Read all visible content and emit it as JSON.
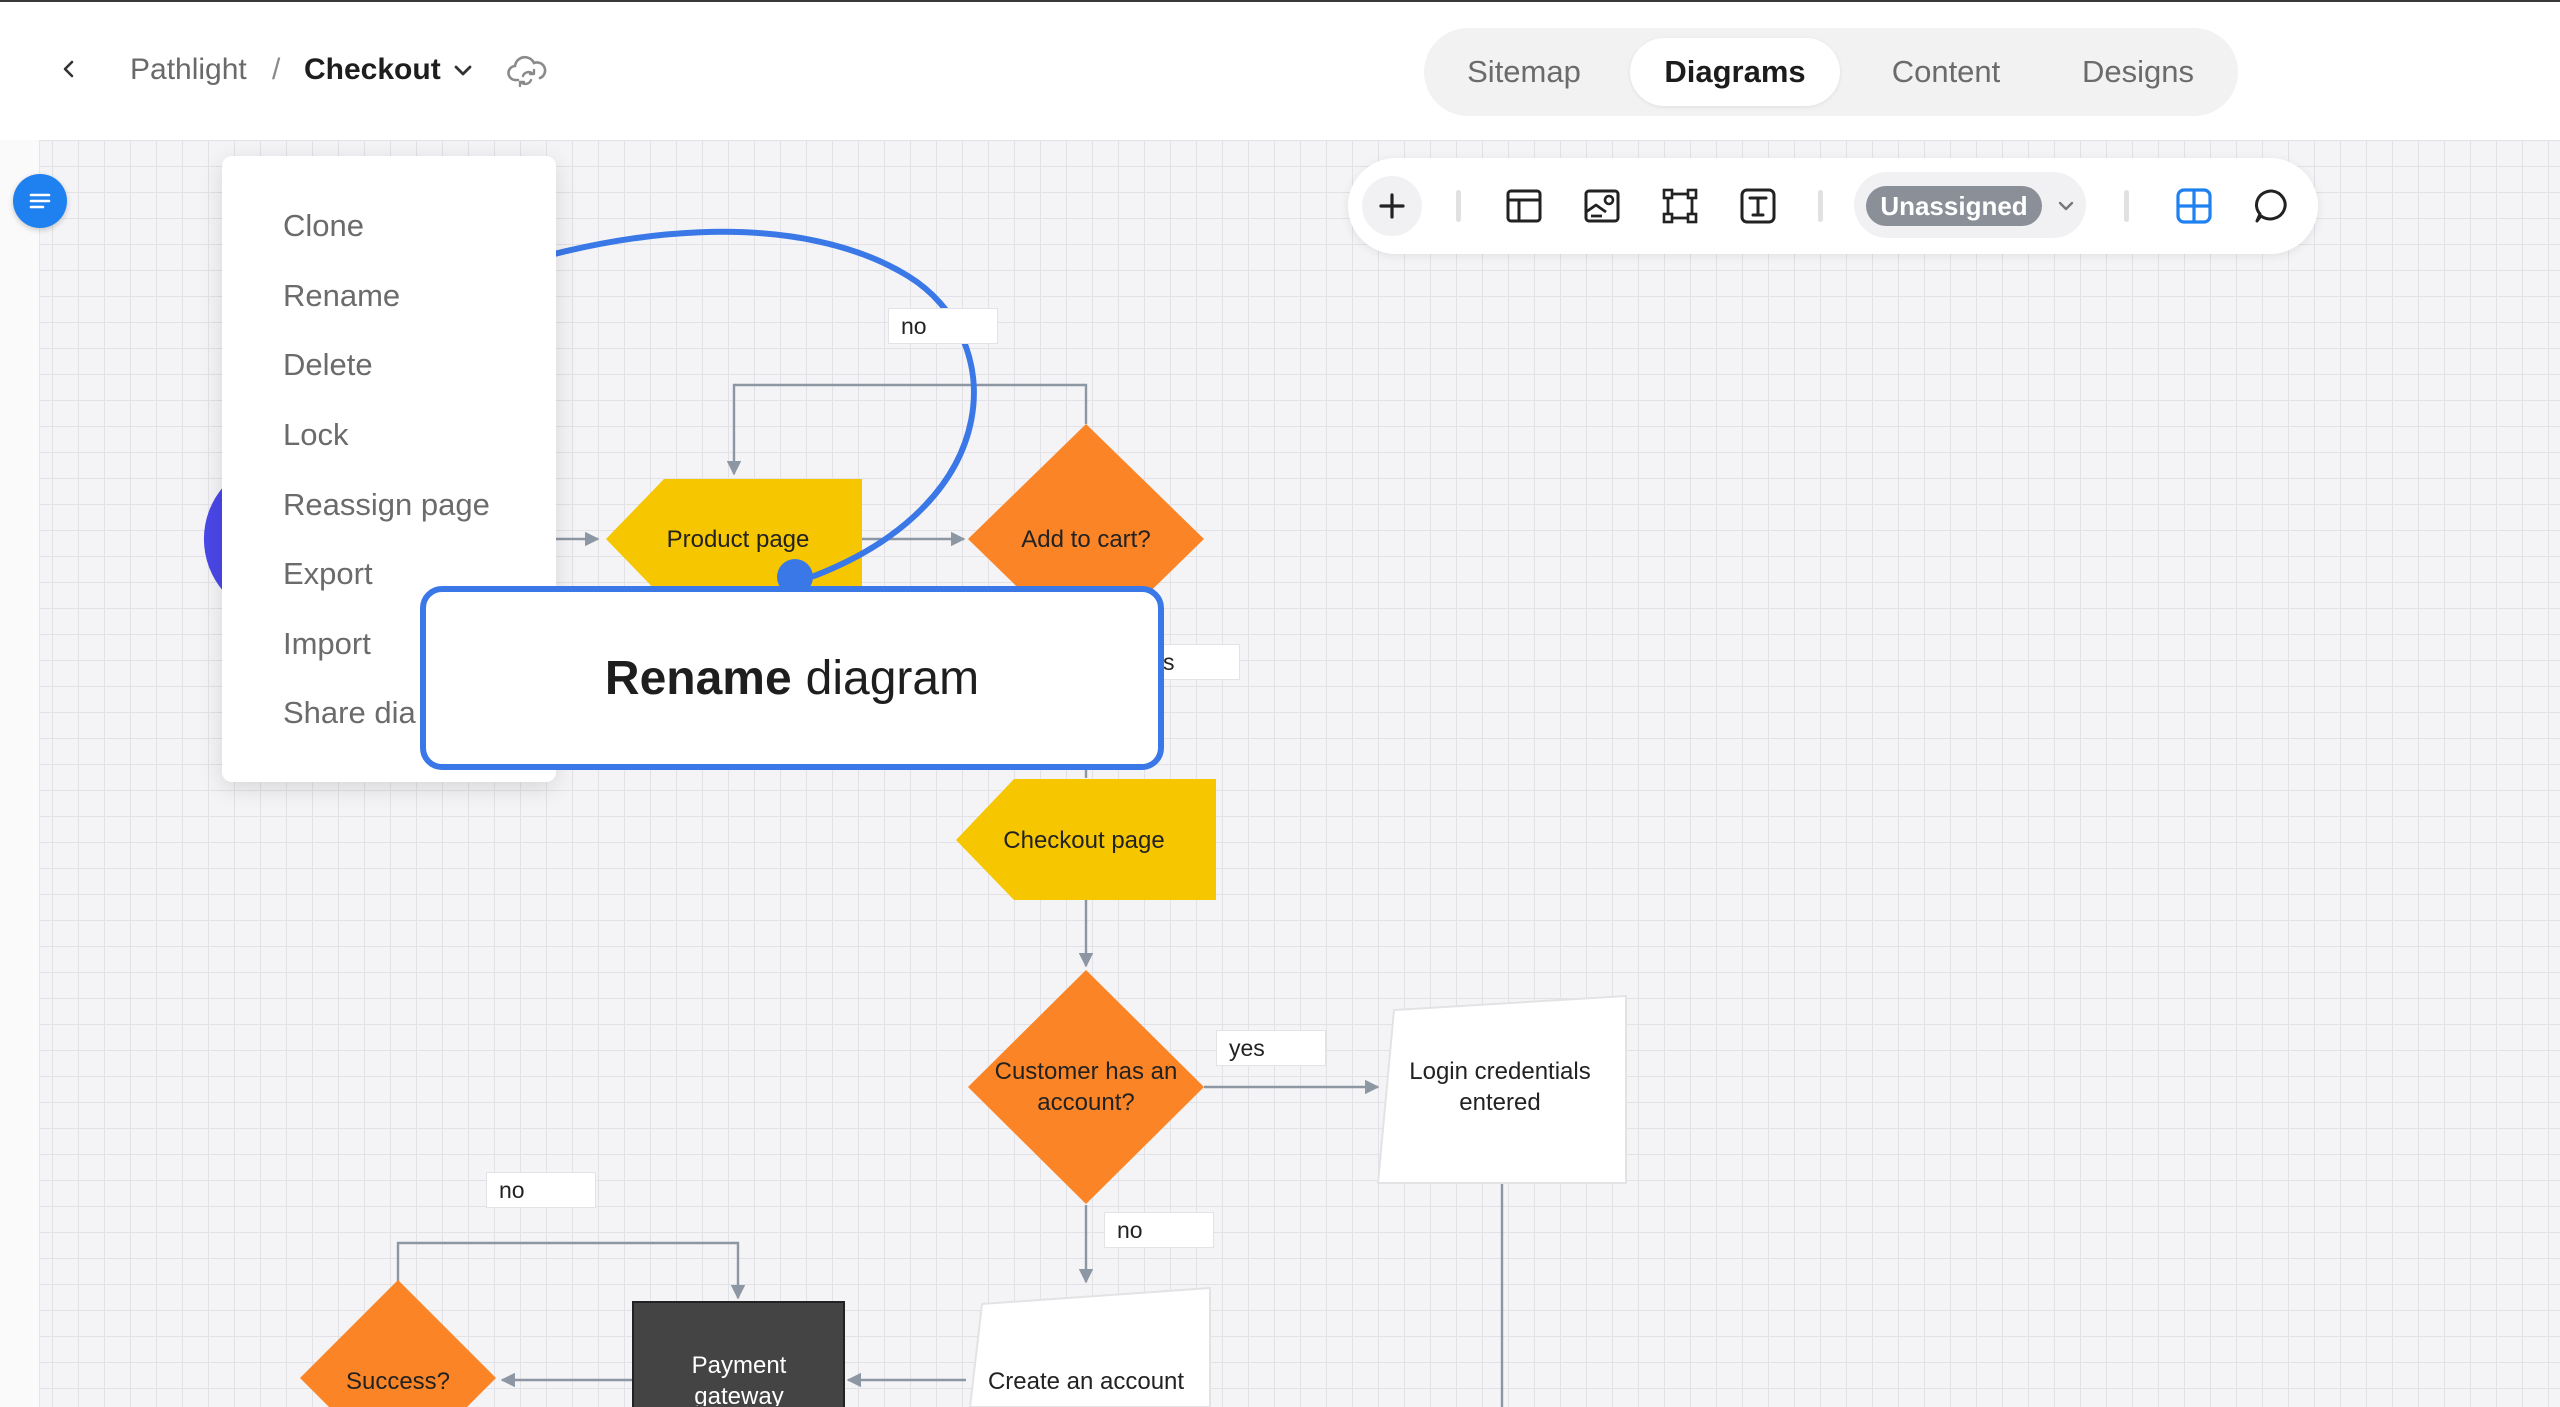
{
  "header": {
    "breadcrumb_root": "Pathlight",
    "breadcrumb_separator": "/",
    "breadcrumb_current": "Checkout",
    "icons": [
      "chevron-left-icon",
      "chevron-down-icon",
      "cloud-sync-icon"
    ]
  },
  "tabs": [
    {
      "label": "Sitemap",
      "active": false
    },
    {
      "label": "Diagrams",
      "active": true
    },
    {
      "label": "Content",
      "active": false
    },
    {
      "label": "Designs",
      "active": false
    }
  ],
  "toolbar": {
    "assignee": "Unassigned",
    "icons": [
      "plus-icon",
      "layout-icon",
      "image-card-icon",
      "frame-icon",
      "text-box-icon",
      "chevron-down-icon",
      "grid-icon",
      "comment-icon"
    ],
    "accent_color": "#1f80f0"
  },
  "context_menu": {
    "items": [
      "Clone",
      "Rename",
      "Delete",
      "Lock",
      "Reassign page",
      "Export",
      "Import",
      "Share dia"
    ]
  },
  "callout": {
    "bold": "Rename",
    "rest": "diagram"
  },
  "flowchart": {
    "nodes": {
      "product_page": "Product page",
      "add_to_cart": "Add to cart?",
      "checkout_page": "Checkout page",
      "customer_has_account": "Customer has an account?",
      "login_credentials": "Login credentials entered",
      "create_account": "Create an account",
      "payment_gateway": "Payment gateway",
      "success": "Success?"
    },
    "edge_labels": {
      "no_top": "no",
      "yes_partial": "s",
      "yes_login": "yes",
      "no_customer": "no",
      "no_success": "no"
    },
    "colors": {
      "page_node": "#f6c600",
      "decision_node": "#fb8526",
      "dark_node": "#444444",
      "start_node": "#4a47e8",
      "connector": "#8d96a3",
      "annotation": "#3b78e7"
    }
  }
}
